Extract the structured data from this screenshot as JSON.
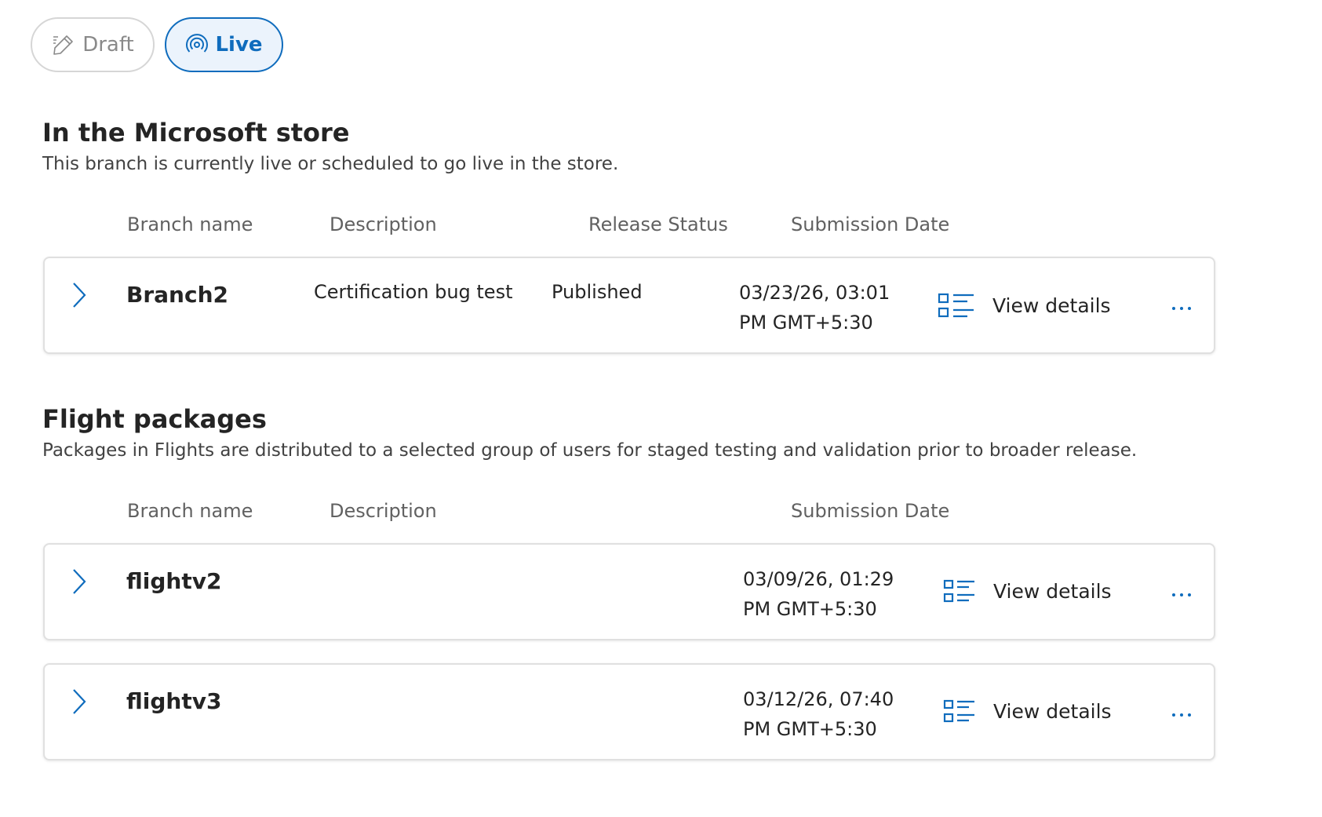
{
  "filter_tabs": {
    "draft_label": "Draft",
    "live_label": "Live",
    "active": "Live"
  },
  "store_section": {
    "title": "In the Microsoft store",
    "description": "This branch is currently live or scheduled to go live in the store.",
    "columns": [
      "Branch name",
      "Description",
      "Release Status",
      "Submission Date"
    ],
    "rows": [
      {
        "branch_name": "Branch2",
        "description": "Certification bug test",
        "release_status": "Published",
        "date_line1": "03/23/26, 03:01",
        "date_line2": "PM GMT+5:30",
        "action_label": "View details"
      }
    ]
  },
  "flight_section": {
    "title": "Flight packages",
    "description": "Packages in Flights are distributed to a selected group of users for staged testing and validation prior to broader release.",
    "columns": [
      "Branch name",
      "Description",
      "Submission Date"
    ],
    "rows": [
      {
        "branch_name": "flightv2",
        "date_line1": "03/09/26, 01:29",
        "date_line2": "PM GMT+5:30",
        "action_label": "View details"
      },
      {
        "branch_name": "flightv3",
        "date_line1": "03/12/26, 07:40",
        "date_line2": "PM GMT+5:30",
        "action_label": "View details"
      }
    ]
  },
  "colors": {
    "accent": "#0f6cbd",
    "active_pill_bg": "#ebf3fc",
    "card_border": "#e0e0e0"
  },
  "icons": [
    "pencil-icon",
    "broadcast-icon",
    "chevron-right-icon",
    "details-list-icon",
    "more-icon"
  ]
}
